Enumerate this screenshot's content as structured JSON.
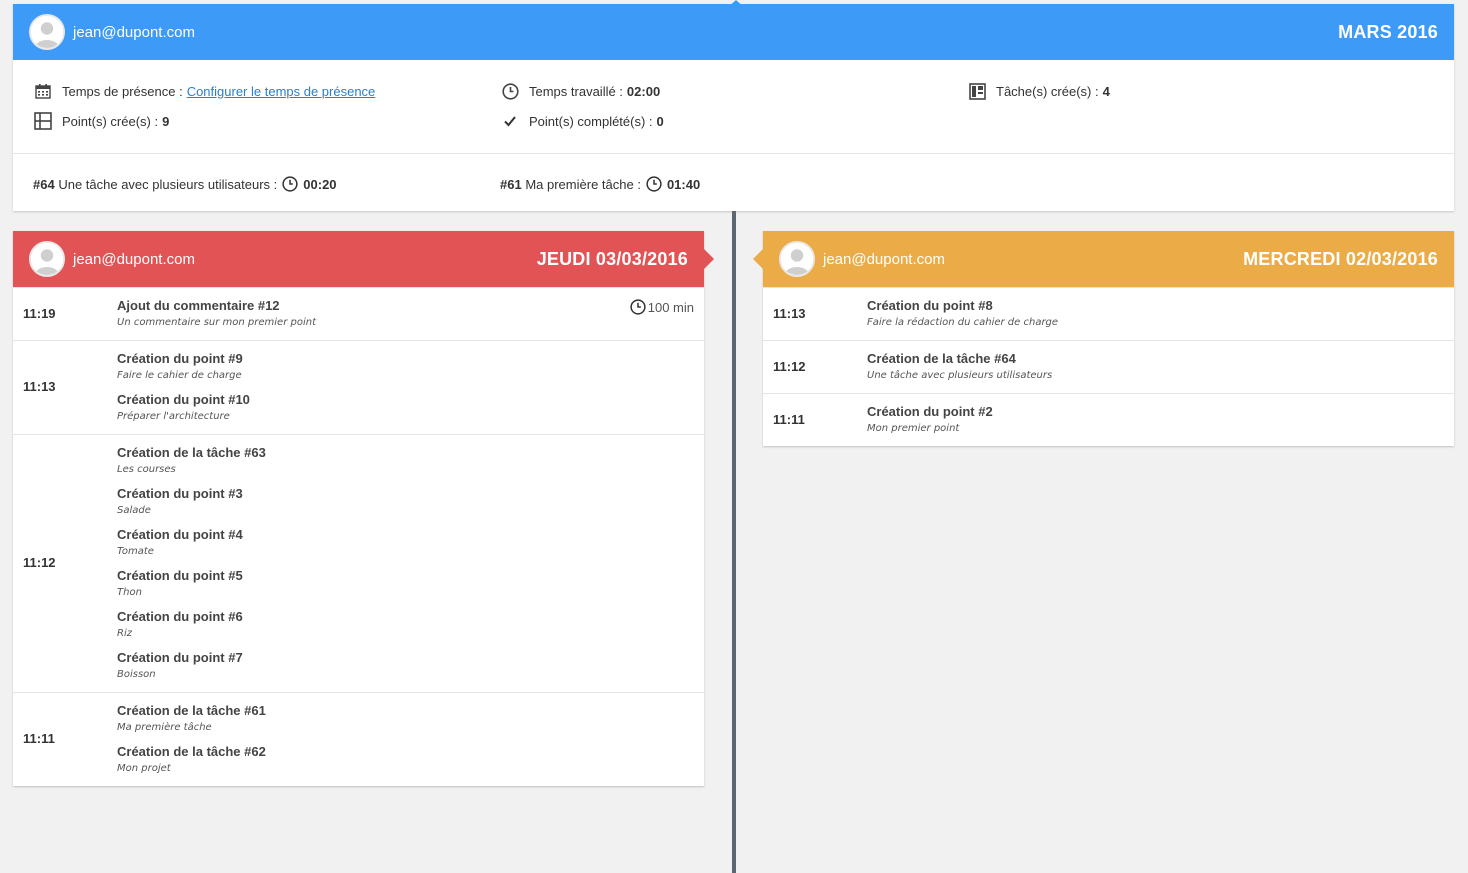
{
  "summary": {
    "user_email": "jean@dupont.com",
    "month_title": "MARS 2016",
    "presence_label": "Temps de présence :",
    "presence_link": "Configurer le temps de présence",
    "points_created_label": "Point(s) crée(s) :",
    "points_created_value": "9",
    "worked_label": "Temps travaillé :",
    "worked_value": "02:00",
    "points_completed_label": "Point(s) complété(s) :",
    "points_completed_value": "0",
    "tasks_created_label": "Tâche(s) crée(s) :",
    "tasks_created_value": "4",
    "tasks": [
      {
        "id": "#64",
        "name": "Une tâche avec plusieurs utilisateurs :",
        "time": "00:20"
      },
      {
        "id": "#61",
        "name": "Ma première tâche :",
        "time": "01:40"
      }
    ]
  },
  "days": [
    {
      "user_email": "jean@dupont.com",
      "title": "JEUDI 03/03/2016",
      "accent": "#e15355",
      "groups": [
        {
          "time": "11:19",
          "duration": "100 min",
          "entries": [
            {
              "title": "Ajout du commentaire #12",
              "desc": "Un commentaire sur mon premier point"
            }
          ]
        },
        {
          "time": "11:13",
          "entries": [
            {
              "title": "Création du point #9",
              "desc": "Faire le cahier de charge"
            },
            {
              "title": "Création du point #10",
              "desc": "Préparer l'architecture"
            }
          ]
        },
        {
          "time": "11:12",
          "entries": [
            {
              "title": "Création de la tâche #63",
              "desc": "Les courses"
            },
            {
              "title": "Création du point #3",
              "desc": "Salade"
            },
            {
              "title": "Création du point #4",
              "desc": "Tomate"
            },
            {
              "title": "Création du point #5",
              "desc": "Thon"
            },
            {
              "title": "Création du point #6",
              "desc": "Riz"
            },
            {
              "title": "Création du point #7",
              "desc": "Boisson"
            }
          ]
        },
        {
          "time": "11:11",
          "entries": [
            {
              "title": "Création de la tâche #61",
              "desc": "Ma première tâche"
            },
            {
              "title": "Création de la tâche #62",
              "desc": "Mon projet"
            }
          ]
        }
      ]
    },
    {
      "user_email": "jean@dupont.com",
      "title": "MERCREDI 02/03/2016",
      "accent": "#ebac48",
      "groups": [
        {
          "time": "11:13",
          "entries": [
            {
              "title": "Création du point #8",
              "desc": "Faire la rédaction du cahier de charge"
            }
          ]
        },
        {
          "time": "11:12",
          "entries": [
            {
              "title": "Création de la tâche #64",
              "desc": "Une tâche avec plusieurs utilisateurs"
            }
          ]
        },
        {
          "time": "11:11",
          "entries": [
            {
              "title": "Création du point #2",
              "desc": "Mon premier point"
            }
          ]
        }
      ]
    }
  ],
  "icons": {
    "calendar": "calendar-icon",
    "clock": "clock-icon",
    "tasks": "tasks-icon",
    "points": "points-icon",
    "check": "check-icon",
    "avatar": "user-avatar-icon"
  }
}
